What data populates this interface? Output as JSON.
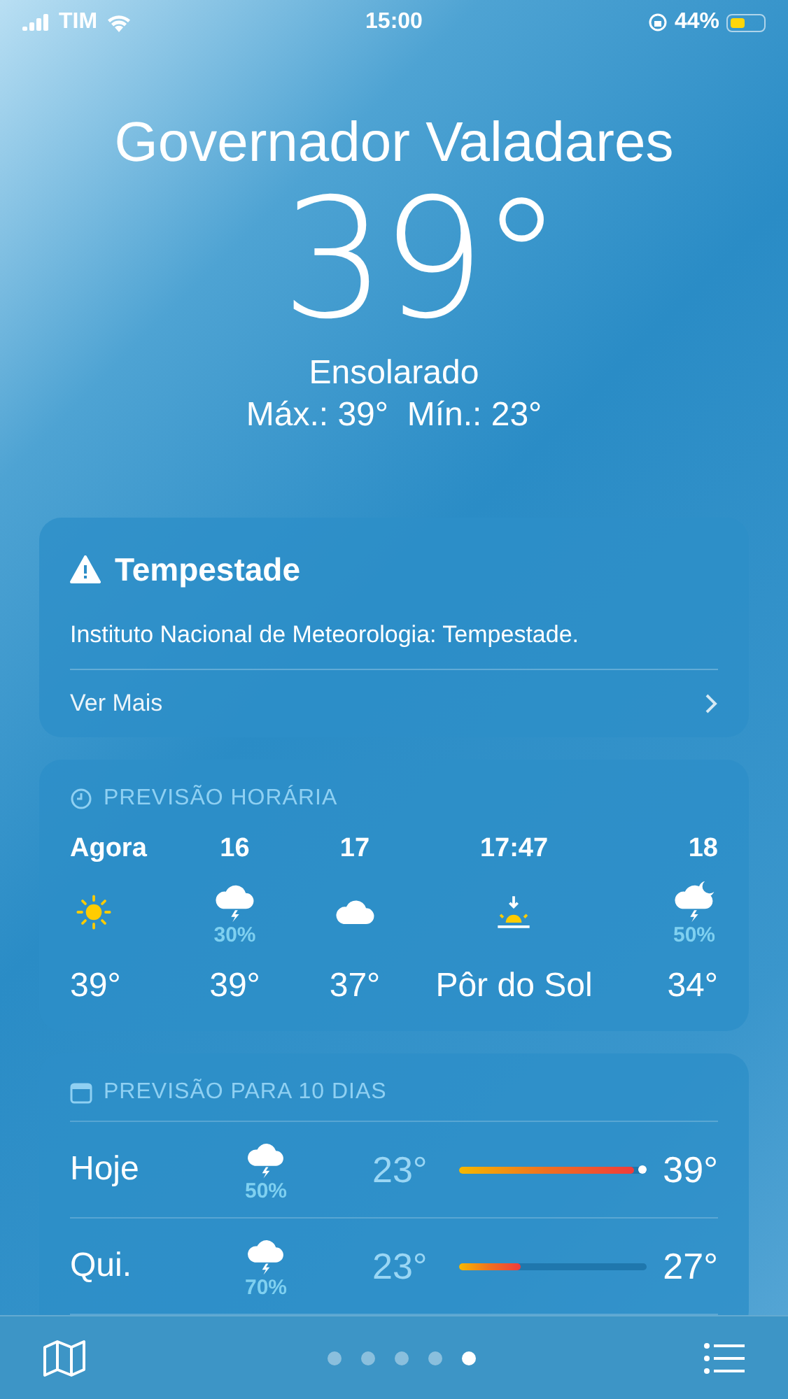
{
  "status_bar": {
    "carrier": "TIM",
    "time": "15:00",
    "battery": "44%"
  },
  "location": {
    "city": "Governador Valadares",
    "temperature": "39°",
    "condition": "Ensolarado",
    "high_low": "Máx.: 39°  Mín.: 23°"
  },
  "alert": {
    "title": "Tempestade",
    "text": "Instituto Nacional de Meteorologia: Tempestade.",
    "link": "Ver Mais"
  },
  "hourly": {
    "title": "PREVISÃO HORÁRIA",
    "items": [
      {
        "time": "Agora",
        "kind": "sun",
        "value": "39°"
      },
      {
        "time": "16",
        "kind": "storm",
        "chance": "30%",
        "value": "39°"
      },
      {
        "time": "17",
        "kind": "cloud",
        "value": "37°"
      },
      {
        "time": "17:47",
        "kind": "sunset",
        "value": "Pôr do Sol"
      },
      {
        "time": "18",
        "kind": "storm-night",
        "chance": "50%",
        "value": "34°"
      }
    ]
  },
  "daily": {
    "title": "PREVISÃO PARA 10 DIAS",
    "rows": [
      {
        "day": "Hoje",
        "kind": "storm",
        "chance": "50%",
        "low": "23°",
        "high": "39°",
        "level": 0.93,
        "current": true
      },
      {
        "day": "Qui.",
        "kind": "storm",
        "chance": "70%",
        "low": "23°",
        "high": "27°",
        "level": 0.33,
        "current": false
      }
    ]
  },
  "pages": [
    {
      "selected": false
    },
    {
      "selected": false
    },
    {
      "selected": false
    },
    {
      "selected": false
    },
    {
      "selected": true
    }
  ]
}
